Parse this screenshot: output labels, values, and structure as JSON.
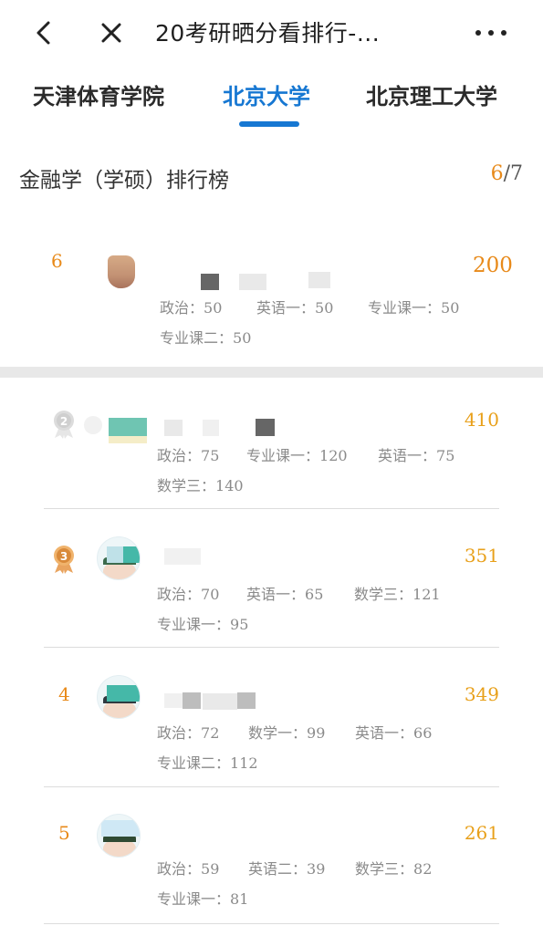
{
  "header": {
    "title": "20考研晒分看排行-...",
    "back_icon": "chevron-left-icon",
    "close_icon": "close-icon",
    "more_icon": "more-horizontal-icon"
  },
  "tabs": [
    {
      "label": "天津体育学院",
      "active": false
    },
    {
      "label": "北京大学",
      "active": true
    },
    {
      "label": "北京理工大学",
      "active": false
    }
  ],
  "ranking": {
    "title": "金融学（学硕）排行榜",
    "page_current": "6",
    "page_sep": "/",
    "page_total": "7"
  },
  "my_entry": {
    "rank": "6",
    "total": "200",
    "subjects": [
      {
        "name": "政治：",
        "score": "50"
      },
      {
        "name": "英语一：",
        "score": "50"
      },
      {
        "name": "专业课一：",
        "score": "50"
      },
      {
        "name": "专业课二：",
        "score": "50"
      }
    ]
  },
  "entries": [
    {
      "rank": "2",
      "total": "410",
      "subjects": [
        {
          "name": "政治：",
          "score": "75"
        },
        {
          "name": "专业课一：",
          "score": "120"
        },
        {
          "name": "英语一：",
          "score": "75"
        },
        {
          "name": "数学三：",
          "score": "140"
        }
      ]
    },
    {
      "rank": "3",
      "total": "351",
      "subjects": [
        {
          "name": "政治：",
          "score": "70"
        },
        {
          "name": "英语一：",
          "score": "65"
        },
        {
          "name": "数学三：",
          "score": "121"
        },
        {
          "name": "专业课一：",
          "score": "95"
        }
      ]
    },
    {
      "rank": "4",
      "total": "349",
      "subjects": [
        {
          "name": "政治：",
          "score": "72"
        },
        {
          "name": "数学一：",
          "score": "99"
        },
        {
          "name": "英语一：",
          "score": "66"
        },
        {
          "name": "专业课二：",
          "score": "112"
        }
      ]
    },
    {
      "rank": "5",
      "total": "261",
      "subjects": [
        {
          "name": "政治：",
          "score": "59"
        },
        {
          "name": "英语二：",
          "score": "39"
        },
        {
          "name": "数学三：",
          "score": "82"
        },
        {
          "name": "专业课一：",
          "score": "81"
        }
      ]
    }
  ],
  "colors": {
    "accent_blue": "#1677d2",
    "rank_orange": "#e88a1a",
    "score_gold": "#e8a01a",
    "muted_text": "#8a8a8a"
  }
}
